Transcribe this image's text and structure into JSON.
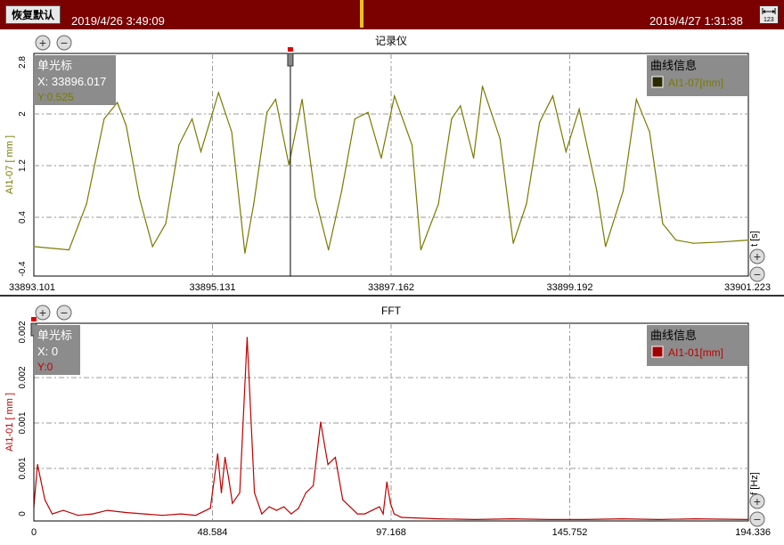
{
  "toolbar": {
    "reset_label": "恢复默认",
    "start_time": "2019/4/26 3:49:09",
    "end_time": "2019/4/27 1:31:38",
    "scale_icon": "axis-scale-icon"
  },
  "colors": {
    "topbar": "#7b0000",
    "recorder_series": "#7a7a00",
    "fft_series": "#c00000",
    "info_box": "#8c8c8c"
  },
  "chart_data": [
    {
      "type": "line",
      "title": "记录仪",
      "xlabel": "t [s]",
      "ylabel": "AI1-07 [ mm ]",
      "x_ticks": [
        "33893.101",
        "33895.131",
        "33897.162",
        "33899.192",
        "33901.223"
      ],
      "y_ticks": [
        "2.8",
        "2",
        "1.2",
        "0.4",
        "-0.4"
      ],
      "xlim": [
        33893.101,
        33901.223
      ],
      "ylim": [
        -0.5,
        2.9
      ],
      "grid": true,
      "series": [
        {
          "name": "AI1-07[mm]",
          "x": [
            33893.101,
            33893.5,
            33893.7,
            33893.9,
            33894.05,
            33894.15,
            33894.3,
            33894.45,
            33894.6,
            33894.75,
            33894.9,
            33895.0,
            33895.2,
            33895.35,
            33895.5,
            33895.6,
            33895.75,
            33895.85,
            33896.0,
            33896.15,
            33896.3,
            33896.45,
            33896.6,
            33896.75,
            33896.9,
            33897.05,
            33897.2,
            33897.4,
            33897.5,
            33897.7,
            33897.85,
            33897.95,
            33898.1,
            33898.2,
            33898.4,
            33898.55,
            33898.7,
            33898.85,
            33899.0,
            33899.15,
            33899.3,
            33899.5,
            33899.6,
            33899.8,
            33899.95,
            33900.1,
            33900.25,
            33900.4,
            33900.6,
            33900.9,
            33901.223
          ],
          "y": [
            -0.05,
            -0.1,
            0.6,
            1.9,
            2.15,
            1.8,
            0.7,
            -0.05,
            0.3,
            1.5,
            1.9,
            1.4,
            2.3,
            1.7,
            -0.15,
            0.6,
            2.0,
            2.2,
            1.2,
            2.2,
            0.7,
            -0.1,
            0.8,
            1.9,
            2.0,
            1.3,
            2.25,
            1.5,
            -0.1,
            0.6,
            1.9,
            2.1,
            1.3,
            2.4,
            1.6,
            0.0,
            0.6,
            1.85,
            2.25,
            1.4,
            2.05,
            0.8,
            -0.05,
            0.8,
            2.2,
            1.7,
            0.3,
            0.05,
            0.0,
            0.02,
            0.05
          ]
        }
      ],
      "cursor": {
        "label": "单光标",
        "x_text": "X: 33896.017",
        "y_text": "Y:0.525",
        "x": 33896.017
      },
      "legend": {
        "title": "曲线信息",
        "placement": "top-right"
      }
    },
    {
      "type": "line",
      "title": "FFT",
      "xlabel": "f [Hz]",
      "ylabel": "AI1-01 [ mm ]",
      "x_ticks": [
        "0",
        "48.584",
        "97.168",
        "145.752",
        "194.336"
      ],
      "y_ticks": [
        "0.002",
        "0.002",
        "0.001",
        "0.001",
        "0"
      ],
      "xlim": [
        0,
        194.336
      ],
      "ylim": [
        0,
        0.0028
      ],
      "grid": true,
      "series": [
        {
          "name": "AI1-01[mm]",
          "x": [
            0,
            1,
            3,
            5,
            8,
            12,
            16,
            20,
            25,
            30,
            35,
            40,
            44,
            48,
            50,
            51,
            52,
            53,
            54,
            56,
            58,
            60,
            62,
            64,
            66,
            68,
            70,
            72,
            74,
            76,
            78,
            80,
            82,
            84,
            86,
            88,
            90,
            92,
            94,
            95,
            96,
            97,
            98,
            100,
            110,
            120,
            130,
            140,
            150,
            160,
            170,
            180,
            194.336
          ],
          "y": [
            0.0002,
            0.0008,
            0.0003,
            0.0001,
            0.00015,
            8e-05,
            0.0001,
            0.00015,
            0.00012,
            0.0001,
            8e-05,
            0.0001,
            8e-05,
            0.00018,
            0.00095,
            0.0004,
            0.0009,
            0.0006,
            0.00025,
            0.0004,
            0.0026,
            0.0004,
            0.0001,
            0.0002,
            0.00015,
            0.0002,
            0.0001,
            0.00018,
            0.0004,
            0.0005,
            0.0014,
            0.0008,
            0.0009,
            0.0003,
            0.0002,
            0.0001,
            0.0001,
            0.00015,
            0.0002,
            0.0001,
            0.00055,
            0.00025,
            0.0001,
            5e-05,
            3e-05,
            2e-05,
            3e-05,
            2e-05,
            2e-05,
            3e-05,
            2e-05,
            3e-05,
            2e-05
          ]
        }
      ],
      "cursor": {
        "label": "单光标",
        "x_text": "X: 0",
        "y_text": "Y:0",
        "x": 0
      },
      "legend": {
        "title": "曲线信息",
        "placement": "top-right"
      }
    }
  ]
}
